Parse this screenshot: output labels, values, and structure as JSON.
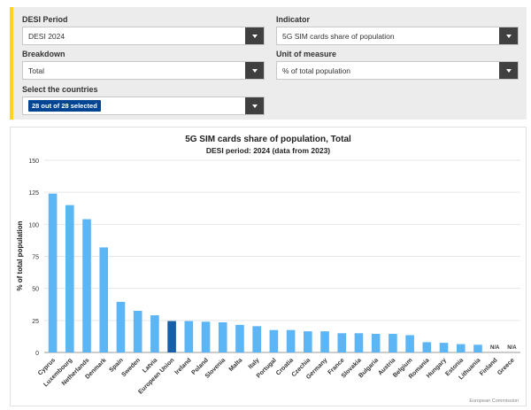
{
  "filters": {
    "desi_period": {
      "label": "DESI Period",
      "value": "DESI 2024"
    },
    "indicator": {
      "label": "Indicator",
      "value": "5G SIM cards share of population"
    },
    "breakdown": {
      "label": "Breakdown",
      "value": "Total"
    },
    "unit": {
      "label": "Unit of measure",
      "value": "% of total population"
    },
    "countries": {
      "label": "Select the countries",
      "value": "28 out of 28 selected"
    }
  },
  "colors": {
    "accent": "#ffd617",
    "bar": "#5cb5f5",
    "bar_highlight": "#1560a8",
    "badge": "#004494",
    "dropdown_arrow_bg": "#404040"
  },
  "icons": {
    "dropdown": "chevron-down-icon"
  },
  "chart_data": {
    "type": "bar",
    "title": "5G SIM cards share of population, Total",
    "subtitle": "DESI period: 2024 (data from 2023)",
    "xlabel": "",
    "ylabel": "% of total population",
    "ylim": [
      0,
      150
    ],
    "yticks": [
      0,
      25,
      50,
      75,
      100,
      125,
      150
    ],
    "grid": true,
    "categories": [
      "Cyprus",
      "Luxembourg",
      "Netherlands",
      "Denmark",
      "Spain",
      "Sweden",
      "Latvia",
      "European Union",
      "Ireland",
      "Poland",
      "Slovenia",
      "Malta",
      "Italy",
      "Portugal",
      "Croatia",
      "Czechia",
      "Germany",
      "France",
      "Slovakia",
      "Bulgaria",
      "Austria",
      "Belgium",
      "Romania",
      "Hungary",
      "Estonia",
      "Lithuania",
      "Finland",
      "Greece"
    ],
    "values": [
      124,
      115,
      104,
      82,
      39.5,
      32.5,
      29,
      24.5,
      24.5,
      24,
      23.5,
      21.5,
      20.5,
      17.5,
      17.5,
      16.5,
      16.5,
      15,
      15,
      14.5,
      14.5,
      13.5,
      8,
      7.5,
      6.5,
      6,
      null,
      null
    ],
    "highlight": "European Union",
    "na_label": "N/A",
    "credit": "European Commission"
  }
}
